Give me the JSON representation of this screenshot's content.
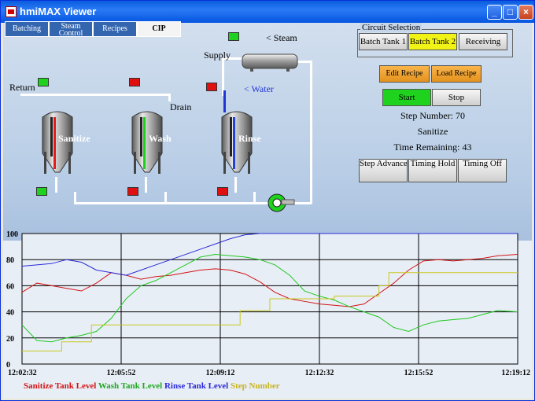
{
  "window": {
    "title": "hmiMAX Viewer"
  },
  "tabs": [
    {
      "label": "Batching"
    },
    {
      "label": "Steam Control"
    },
    {
      "label": "Recipes"
    },
    {
      "label": "CIP"
    }
  ],
  "process": {
    "steam_label": "< Steam",
    "supply_label": "Supply",
    "return_label": "Return",
    "drain_label": "Drain",
    "water_label": "< Water",
    "tanks": [
      {
        "label": "Sanitize",
        "color": "#e21b1b"
      },
      {
        "label": "Wash",
        "color": "#1bd21b"
      },
      {
        "label": "Rinse",
        "color": "#2040e0"
      }
    ]
  },
  "circuit": {
    "title": "Circuit Selection",
    "buttons": [
      "Batch Tank 1",
      "Batch Tank 2",
      "Receiving"
    ],
    "selected": "Batch Tank 2"
  },
  "recipe": {
    "edit_label": "Edit Recipe",
    "load_label": "Load Recipe"
  },
  "control": {
    "start_label": "Start",
    "stop_label": "Stop"
  },
  "status": {
    "step_number": "Step Number: 70",
    "step_name": "Sanitize",
    "time_remaining": "Time Remaining: 43"
  },
  "steps": {
    "advance_label": "Step Advance",
    "hold_label": "Timing Hold",
    "off_label": "Timing Off"
  },
  "chart_data": {
    "type": "line",
    "x_ticks": [
      "12:02:32",
      "12:05:52",
      "12:09:12",
      "12:12:32",
      "12:15:52",
      "12:19:12"
    ],
    "y_ticks": [
      "0",
      "20",
      "40",
      "60",
      "80",
      "100"
    ],
    "ylim": [
      0,
      100
    ],
    "grid": true,
    "legend_position": "bottom",
    "series": [
      {
        "name": "Sanitize Tank Level",
        "color": "#d21414",
        "points": [
          [
            0,
            55
          ],
          [
            3,
            62
          ],
          [
            6,
            60
          ],
          [
            9,
            58
          ],
          [
            12,
            56
          ],
          [
            15,
            62
          ],
          [
            18,
            70
          ],
          [
            21,
            68
          ],
          [
            24,
            65
          ],
          [
            27,
            67
          ],
          [
            30,
            68
          ],
          [
            33,
            70
          ],
          [
            36,
            72
          ],
          [
            39,
            73
          ],
          [
            42,
            72
          ],
          [
            45,
            69
          ],
          [
            48,
            63
          ],
          [
            51,
            55
          ],
          [
            54,
            50
          ],
          [
            57,
            48
          ],
          [
            60,
            46
          ],
          [
            63,
            45
          ],
          [
            66,
            44
          ],
          [
            69,
            46
          ],
          [
            72,
            54
          ],
          [
            75,
            62
          ],
          [
            78,
            72
          ],
          [
            81,
            79
          ],
          [
            84,
            80
          ],
          [
            87,
            79
          ],
          [
            90,
            80
          ],
          [
            93,
            81
          ],
          [
            96,
            83
          ],
          [
            100,
            84
          ]
        ]
      },
      {
        "name": "Wash Tank Level",
        "color": "#1fc81f",
        "points": [
          [
            0,
            30
          ],
          [
            3,
            18
          ],
          [
            6,
            17
          ],
          [
            9,
            20
          ],
          [
            12,
            22
          ],
          [
            15,
            25
          ],
          [
            18,
            35
          ],
          [
            21,
            50
          ],
          [
            24,
            60
          ],
          [
            27,
            64
          ],
          [
            30,
            70
          ],
          [
            33,
            76
          ],
          [
            36,
            82
          ],
          [
            39,
            84
          ],
          [
            42,
            83
          ],
          [
            45,
            82
          ],
          [
            48,
            80
          ],
          [
            51,
            76
          ],
          [
            54,
            68
          ],
          [
            57,
            56
          ],
          [
            60,
            52
          ],
          [
            63,
            49
          ],
          [
            66,
            44
          ],
          [
            69,
            40
          ],
          [
            72,
            36
          ],
          [
            75,
            28
          ],
          [
            78,
            25
          ],
          [
            81,
            30
          ],
          [
            84,
            33
          ],
          [
            87,
            34
          ],
          [
            90,
            35
          ],
          [
            93,
            38
          ],
          [
            96,
            41
          ],
          [
            100,
            40
          ]
        ]
      },
      {
        "name": "Rinse Tank Level",
        "color": "#2a2ad8",
        "points": [
          [
            0,
            75
          ],
          [
            3,
            76
          ],
          [
            6,
            77
          ],
          [
            9,
            80
          ],
          [
            12,
            78
          ],
          [
            15,
            72
          ],
          [
            18,
            70
          ],
          [
            21,
            68
          ],
          [
            24,
            72
          ],
          [
            27,
            76
          ],
          [
            30,
            80
          ],
          [
            33,
            84
          ],
          [
            36,
            88
          ],
          [
            39,
            92
          ],
          [
            42,
            96
          ],
          [
            45,
            99
          ],
          [
            48,
            100
          ],
          [
            100,
            100
          ]
        ]
      },
      {
        "name": "Step Number",
        "color": "#c8c81e",
        "points": [
          [
            0,
            10
          ],
          [
            8,
            10
          ],
          [
            8,
            17
          ],
          [
            14,
            17
          ],
          [
            14,
            30
          ],
          [
            44,
            30
          ],
          [
            44,
            41
          ],
          [
            50,
            41
          ],
          [
            50,
            50
          ],
          [
            63,
            50
          ],
          [
            63,
            52
          ],
          [
            72,
            52
          ],
          [
            72,
            60
          ],
          [
            74,
            60
          ],
          [
            74,
            70
          ],
          [
            100,
            70
          ]
        ]
      }
    ]
  }
}
